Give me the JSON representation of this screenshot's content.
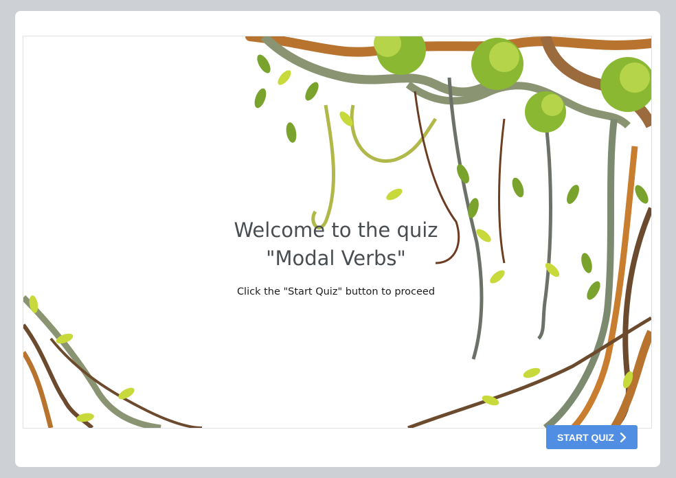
{
  "slide": {
    "title_line1": "Welcome to the quiz",
    "title_line2": "\"Modal Verbs\"",
    "instruction": "Click the \"Start Quiz\" button to proceed"
  },
  "footer": {
    "start_label": "START QUIZ",
    "start_icon": "chevron-right-icon"
  },
  "colors": {
    "page_bg": "#cdd1d5",
    "card_bg": "#ffffff",
    "button_bg": "#4f8ee2",
    "title_text": "#484d52",
    "leaf_light": "#a8c93a",
    "leaf_dark": "#5f8f2a",
    "vine_gray": "#7c8a6f",
    "branch_brown": "#b8742f"
  }
}
